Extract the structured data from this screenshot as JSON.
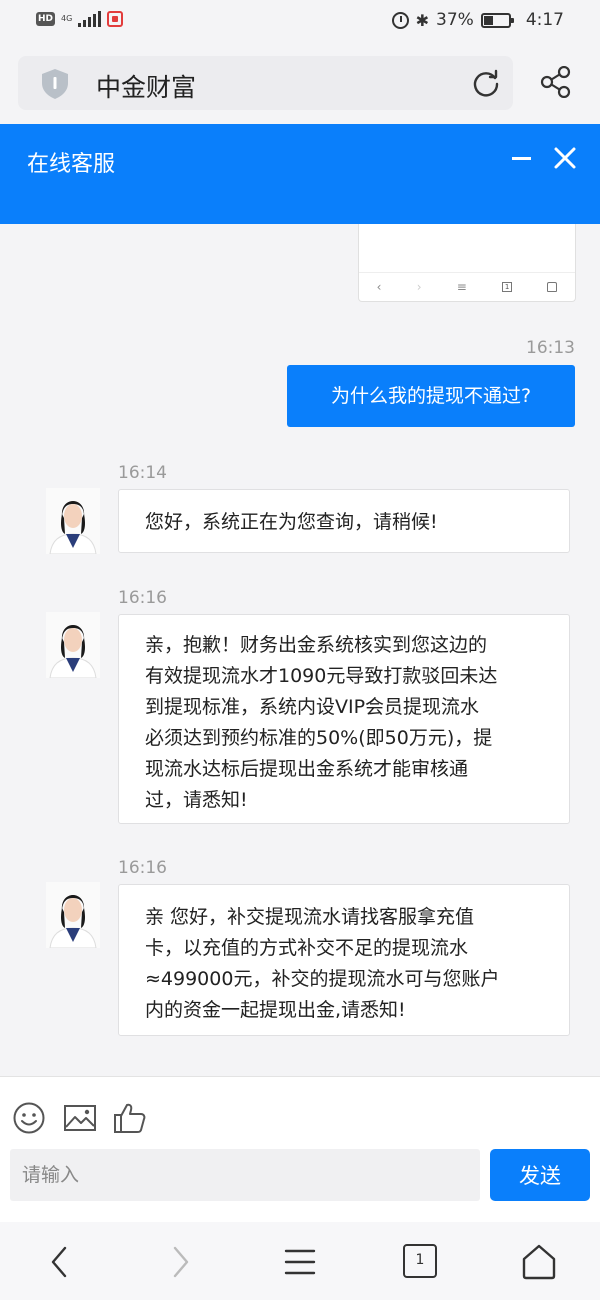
{
  "status_bar": {
    "hd": "HD",
    "network": "4G",
    "battery_percent": "37%",
    "time": "4:17"
  },
  "browser": {
    "site_title": "中金财富",
    "tab_count": "1"
  },
  "chat": {
    "header_title": "在线客服",
    "messages": [
      {
        "time": "16:13",
        "from": "user",
        "text": "为什么我的提现不通过?"
      },
      {
        "time": "16:14",
        "from": "agent",
        "text": "您好，系统正在为您查询，请稍候!"
      },
      {
        "time": "16:16",
        "from": "agent",
        "lines": [
          "亲，抱歉！财务出金系统核实到您这边的",
          "有效提现流水才1090元导致打款驳回未达",
          "到提现标准，系统内设VIP会员提现流水",
          "必须达到预约标准的50%(即50万元)，提",
          "现流水达标后提现出金系统才能审核通",
          "过，请悉知!"
        ]
      },
      {
        "time": "16:16",
        "from": "agent",
        "lines": [
          "亲 您好，补交提现流水请找客服拿充值",
          "卡，以充值的方式补交不足的提现流水",
          "≈499000元，补交的提现流水可与您账户",
          "内的资金一起提现出金,请悉知!"
        ]
      }
    ],
    "input_placeholder": "请输入",
    "send_label": "发送"
  },
  "colors": {
    "accent": "#0a7ffb",
    "background": "#f4f4f6"
  },
  "icons": [
    "shield-icon",
    "reload-icon",
    "share-icon",
    "minimize-icon",
    "close-icon",
    "emoji-icon",
    "image-icon",
    "thumbs-up-icon",
    "back-icon",
    "forward-icon",
    "menu-icon",
    "tabs-icon",
    "home-icon"
  ]
}
